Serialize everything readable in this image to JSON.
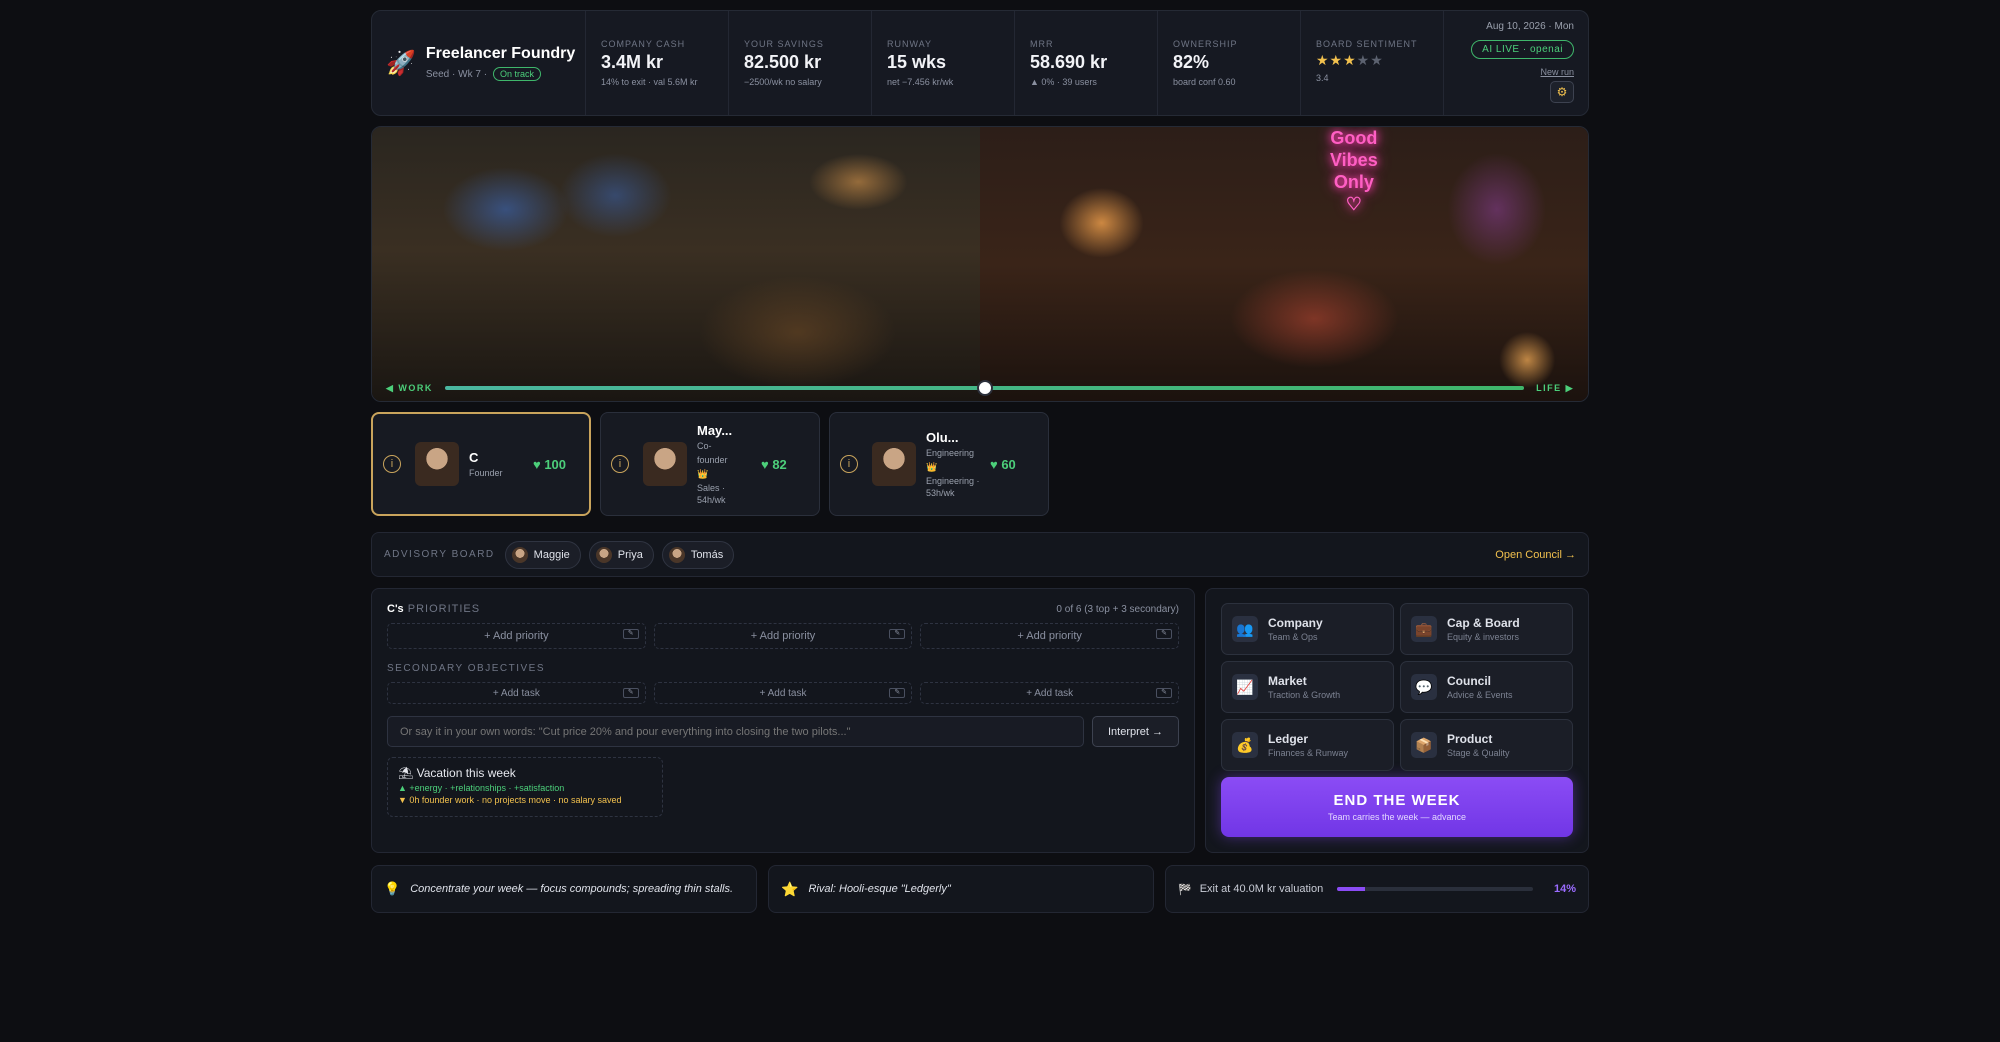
{
  "brand": {
    "title": "Freelancer Foundry",
    "sub": "Seed · Wk 7 ·",
    "status": "On track"
  },
  "stats": [
    {
      "label": "COMPANY CASH",
      "value": "3.4M kr",
      "sub": "14% to exit · val 5.6M kr"
    },
    {
      "label": "YOUR SAVINGS",
      "value": "82.500 kr",
      "sub": "−2500/wk no salary"
    },
    {
      "label": "RUNWAY",
      "value": "15 wks",
      "sub": "net −7.456 kr/wk"
    },
    {
      "label": "MRR",
      "value": "58.690 kr",
      "sub": "▲ 0% · 39 users"
    },
    {
      "label": "OWNERSHIP",
      "value": "82%",
      "sub": "board conf 0.60"
    }
  ],
  "board_sentiment": {
    "label": "BOARD SENTIMENT",
    "stars_on": "★★★",
    "stars_off": "★★",
    "value": "3.4",
    "rating": 3.4
  },
  "header_right": {
    "date": "Aug 10, 2026 · Mon",
    "ai_status": "AI LIVE · openai",
    "new_run": "New run",
    "gear_icon": "⚙"
  },
  "scene": {
    "neon_line1": "Good",
    "neon_line2": "Vibes",
    "neon_line3": "Only",
    "neon_heart": "♡",
    "work_label": "◀ WORK",
    "life_label": "LIFE ▶",
    "balance": 0.5
  },
  "team": [
    {
      "name": "C",
      "role1": "Founder",
      "role2": "",
      "role3": "",
      "energy": "♥ 100"
    },
    {
      "name": "May...",
      "role1": "Co-",
      "role2": "founder",
      "role3": "Sales · 54h/wk",
      "energy": "♥ 82"
    },
    {
      "name": "Olu...",
      "role1": "Engineering",
      "role2": "",
      "role3": "Engineering · 53h/wk",
      "energy": "♥ 60"
    }
  ],
  "advisory": {
    "label": "ADVISORY BOARD",
    "members": [
      "Maggie",
      "Priya",
      "Tomás"
    ],
    "open_council": "Open Council →"
  },
  "priorities": {
    "owner": "C's",
    "title": "PRIORITIES",
    "count": "0 of 6 (3 top + 3 secondary)",
    "add_priority": "+ Add priority",
    "secondary_label": "SECONDARY OBJECTIVES",
    "add_task": "+ Add task",
    "input_placeholder": "Or say it in your own words: \"Cut price 20% and pour everything into closing the two pilots...\"",
    "interpret": "Interpret →",
    "vacation_title": "Vacation this week",
    "vacation_pos": "▲ +energy · +relationships · +satisfaction",
    "vacation_neg": "▼ 0h founder work · no projects move · no salary saved"
  },
  "actions": [
    {
      "title": "Company",
      "sub": "Team & Ops",
      "icon": "👥"
    },
    {
      "title": "Cap & Board",
      "sub": "Equity & investors",
      "icon": "💼"
    },
    {
      "title": "Market",
      "sub": "Traction & Growth",
      "icon": "📈"
    },
    {
      "title": "Council",
      "sub": "Advice & Events",
      "icon": "💬"
    },
    {
      "title": "Ledger",
      "sub": "Finances & Runway",
      "icon": "💰"
    },
    {
      "title": "Product",
      "sub": "Stage & Quality",
      "icon": "📦"
    }
  ],
  "end_week": {
    "title": "END THE WEEK",
    "sub": "Team carries the week — advance"
  },
  "footer": {
    "tip": "Concentrate your week — focus compounds; spreading thin stalls.",
    "rival": "Rival: Hooli-esque \"Ledgerly\"",
    "exit": "Exit at 40.0M kr valuation",
    "exit_pct": "14%",
    "exit_progress": 0.14
  }
}
